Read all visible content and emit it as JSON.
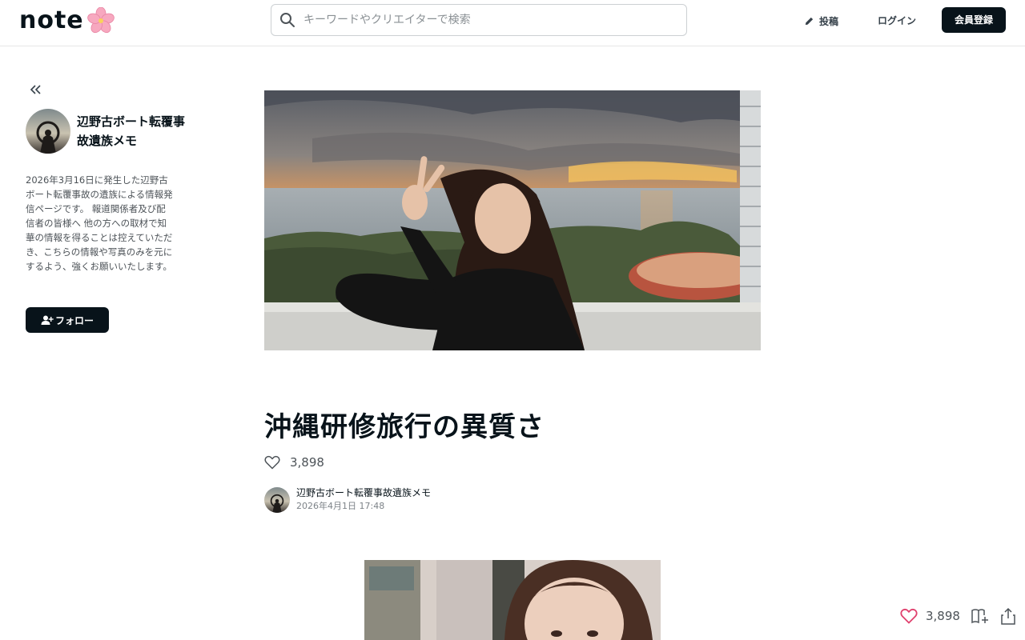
{
  "header": {
    "logo_text": "note",
    "search_placeholder": "キーワードやクリエイターで検索",
    "post_label": "投稿",
    "login_label": "ログイン",
    "signup_label": "会員登録"
  },
  "sidebar": {
    "creator_name": "辺野古ボート転覆事故遺族メモ",
    "bio": "2026年3月16日に発生した辺野古ボート転覆事故の遺族による情報発信ページです。 報道関係者及び配信者の皆様へ 他の方への取材で知華の情報を得ることは控えていただき、こちらの情報や写真のみを元にするよう、強くお願いいたします。",
    "follow_label": "フォロー"
  },
  "article": {
    "title": "沖縄研修旅行の異質さ",
    "like_count": "3,898",
    "author_name": "辺野古ボート転覆事故遺族メモ",
    "date": "2026年4月1日 17:48"
  },
  "float_bar": {
    "like_count": "3,898"
  },
  "colors": {
    "primary_dark": "#08131a",
    "heart_pink": "#e0416e",
    "border": "#e6e6e6"
  },
  "icons": [
    "note-flower-icon",
    "search-icon",
    "pen-icon",
    "collapse-chevrons-icon",
    "add-user-icon",
    "heart-icon",
    "magazine-add-icon",
    "share-icon"
  ]
}
